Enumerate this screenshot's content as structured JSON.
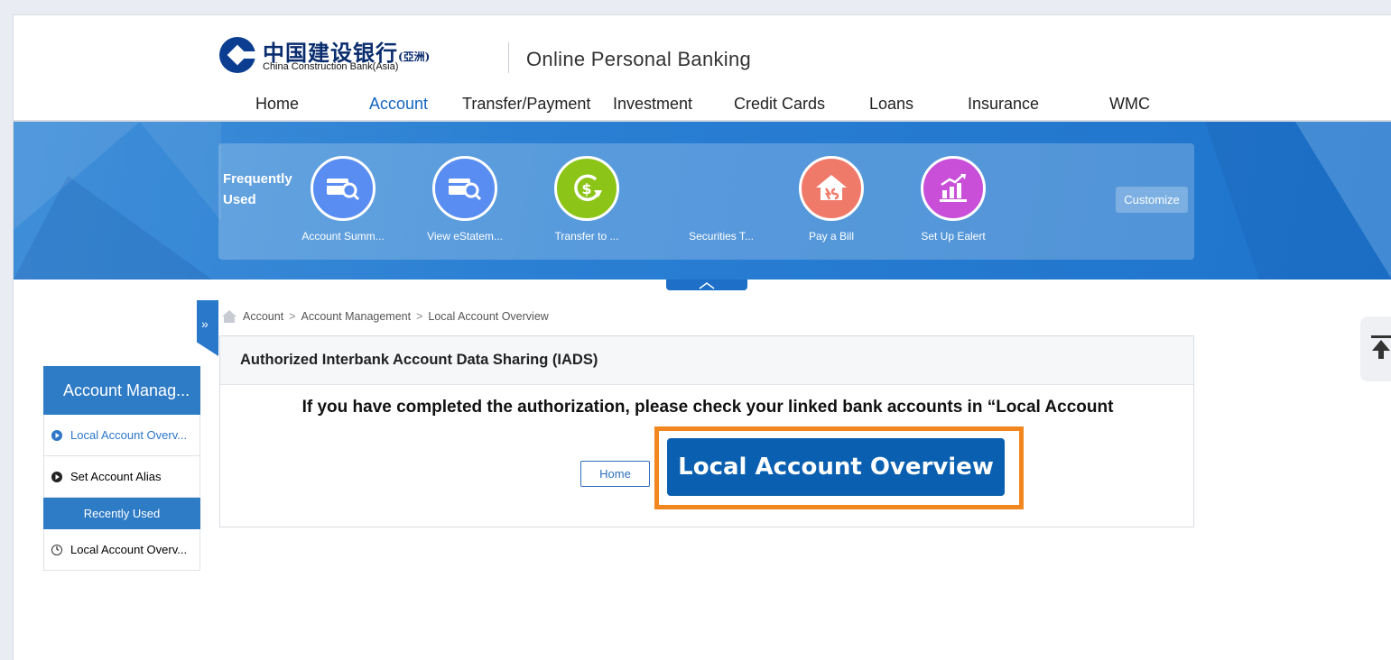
{
  "header": {
    "brand_cn": "中国建设银行",
    "brand_cn_suffix": "(亞洲)",
    "brand_en": "China Construction Bank(Asia)",
    "site_title": "Online Personal Banking"
  },
  "nav": {
    "items": [
      {
        "label": "Home"
      },
      {
        "label": "Account"
      },
      {
        "label": "Transfer/Payment"
      },
      {
        "label": "Investment"
      },
      {
        "label": "Credit Cards"
      },
      {
        "label": "Loans"
      },
      {
        "label": "Insurance"
      },
      {
        "label": "WMC"
      }
    ],
    "active": "Account"
  },
  "frequently_used": {
    "title": "Frequently Used",
    "items": [
      {
        "label": "Account Summ...",
        "icon": "account-search-icon",
        "color": "#5a8df2"
      },
      {
        "label": "View eStatem...",
        "icon": "statement-search-icon",
        "color": "#5a8df2"
      },
      {
        "label": "Transfer to ...",
        "icon": "transfer-money-icon",
        "color": "#8cc417"
      },
      {
        "label": "Securities T...",
        "icon": "",
        "color": ""
      },
      {
        "label": "Pay a Bill",
        "icon": "bill-house-icon",
        "color": "#f07a6a"
      },
      {
        "label": "Set Up Ealert",
        "icon": "chart-alert-icon",
        "color": "#c94fd8"
      }
    ],
    "customize_label": "Customize"
  },
  "breadcrumb": {
    "items": [
      "Account",
      "Account Management",
      "Local Account Overview"
    ],
    "separator": ">"
  },
  "left_menu": {
    "title": "Account Manag...",
    "items": [
      {
        "label": "Local Account Overv...",
        "selected": true
      },
      {
        "label": "Set Account Alias",
        "selected": false
      }
    ],
    "recent_title": "Recently Used",
    "recent_items": [
      {
        "label": "Local Account Overv..."
      }
    ]
  },
  "panel": {
    "title": "Authorized Interbank Account Data Sharing (IADS)",
    "message": "If you have completed the authorization, please check your linked bank accounts in “Local Account",
    "home_button": "Home",
    "overview_button": "Local Account Overview"
  },
  "colors": {
    "accent": "#2f7cc6",
    "banner": "#2a7fd3",
    "highlight": "#f2861f",
    "primary_button": "#0b5fb0"
  }
}
